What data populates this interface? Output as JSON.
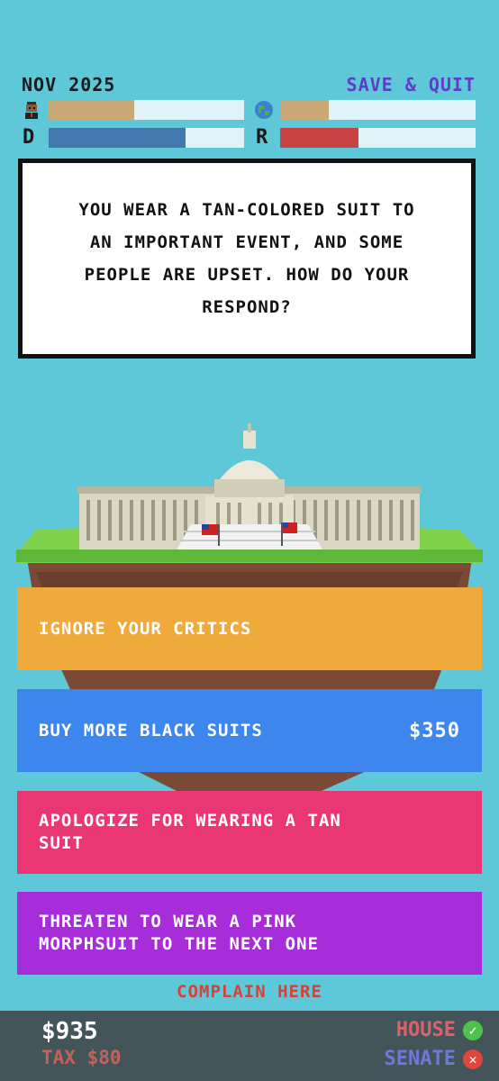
{
  "header": {
    "date": "NOV 2025",
    "save_quit": "SAVE & QUIT"
  },
  "meters": {
    "personal": 0.44,
    "world": 0.25,
    "democrat": 0.7,
    "republican": 0.4,
    "d_label": "D",
    "r_label": "R"
  },
  "colors": {
    "tan": "#c9a878",
    "blue": "#4279ad",
    "red": "#c74344",
    "track": "#dff4f8",
    "orange": "#f0a93b",
    "choice_blue": "#3d86ee",
    "pink": "#ea3773",
    "purple": "#a72ddb",
    "bg": "#5ec7d8"
  },
  "prompt": "YOU WEAR A TAN-COLORED SUIT TO AN IMPORTANT EVENT, AND SOME PEOPLE ARE UPSET. HOW DO YOUR RESPOND?",
  "choices": [
    {
      "label": "IGNORE YOUR CRITICS",
      "cost": ""
    },
    {
      "label": "BUY MORE BLACK SUITS",
      "cost": "$350"
    },
    {
      "label": "APOLOGIZE FOR WEARING A TAN SUIT",
      "cost": ""
    },
    {
      "label": "THREATEN TO WEAR A PINK MORPHSUIT TO THE NEXT ONE",
      "cost": ""
    }
  ],
  "complain": "COMPLAIN HERE",
  "footer": {
    "money": "$935",
    "tax": "TAX $80",
    "house": "HOUSE",
    "senate": "SENATE",
    "house_status": "check-icon",
    "senate_status": "x-icon"
  },
  "icons": {
    "personal": "person-icon",
    "world": "globe-icon",
    "building": "capitol-building"
  }
}
